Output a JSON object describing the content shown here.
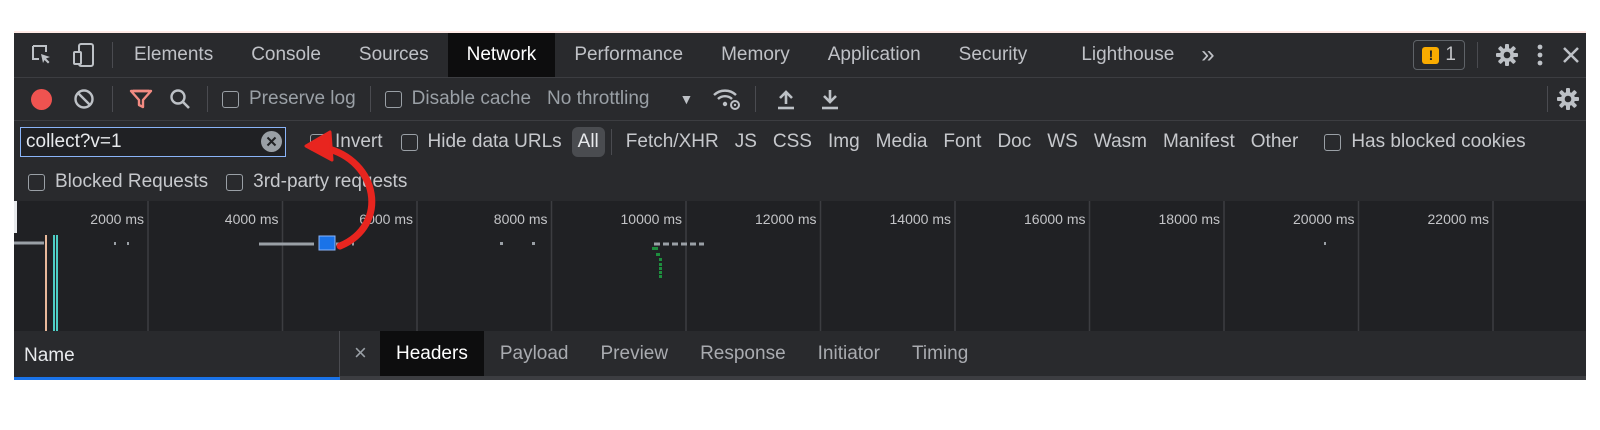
{
  "main_tabs": [
    "Elements",
    "Console",
    "Sources",
    "Network",
    "Performance",
    "Memory",
    "Application",
    "Security",
    "Lighthouse"
  ],
  "more_tabs_glyph": "»",
  "issues_count": "1",
  "toolbar": {
    "preserve_log": "Preserve log",
    "disable_cache": "Disable cache",
    "throttling": "No throttling"
  },
  "filter": {
    "value": "collect?v=1",
    "invert": "Invert",
    "hide_data_urls": "Hide data URLs",
    "types": [
      "All",
      "Fetch/XHR",
      "JS",
      "CSS",
      "Img",
      "Media",
      "Font",
      "Doc",
      "WS",
      "Wasm",
      "Manifest",
      "Other"
    ],
    "has_blocked_cookies": "Has blocked cookies",
    "blocked_requests": "Blocked Requests",
    "third_party": "3rd-party requests"
  },
  "timeline_ticks": [
    "2000 ms",
    "4000 ms",
    "6000 ms",
    "8000 ms",
    "10000 ms",
    "12000 ms",
    "14000 ms",
    "16000 ms",
    "18000 ms",
    "20000 ms",
    "22000 ms"
  ],
  "bottom": {
    "name_header": "Name",
    "close_glyph": "×",
    "detail_tabs": [
      "Headers",
      "Payload",
      "Preview",
      "Response",
      "Initiator",
      "Timing"
    ]
  },
  "colors": {
    "annotation_arrow": "#e8251f",
    "record": "#ef5350",
    "filter_active": "#f28b82"
  }
}
